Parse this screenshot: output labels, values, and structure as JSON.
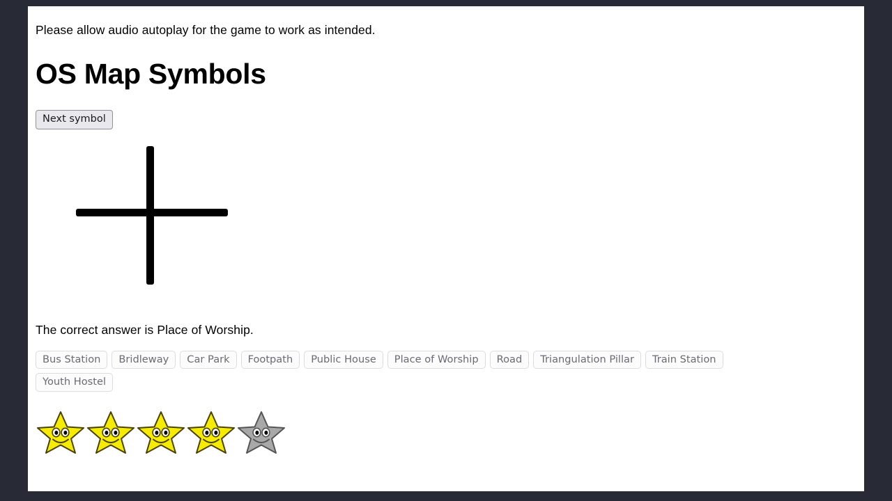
{
  "window": {
    "background_color": "#282a36",
    "page_background": "#ffffff"
  },
  "notice": "Please allow audio autoplay for the game to work as intended.",
  "header": {
    "title": "OS Map Symbols"
  },
  "toolbar": {
    "next_symbol_label": "Next symbol"
  },
  "symbol": {
    "name": "place-of-worship-cross",
    "description": "Large black cross (plus shape) map symbol",
    "stroke_color": "#000000"
  },
  "feedback": {
    "text": "The correct answer is Place of Worship.",
    "correct_answer": "Place of Worship"
  },
  "choices": [
    {
      "label": "Bus Station"
    },
    {
      "label": "Bridleway"
    },
    {
      "label": "Car Park"
    },
    {
      "label": "Footpath"
    },
    {
      "label": "Public House"
    },
    {
      "label": "Place of Worship"
    },
    {
      "label": "Road"
    },
    {
      "label": "Triangulation Pillar"
    },
    {
      "label": "Train Station"
    },
    {
      "label": "Youth Hostel"
    }
  ],
  "score": {
    "total_stars": 5,
    "earned_stars": 4,
    "filled_color": "#f5ec00",
    "empty_color": "#a8a8a8",
    "stars": [
      {
        "state": "filled"
      },
      {
        "state": "filled"
      },
      {
        "state": "filled"
      },
      {
        "state": "filled"
      },
      {
        "state": "empty"
      }
    ]
  }
}
